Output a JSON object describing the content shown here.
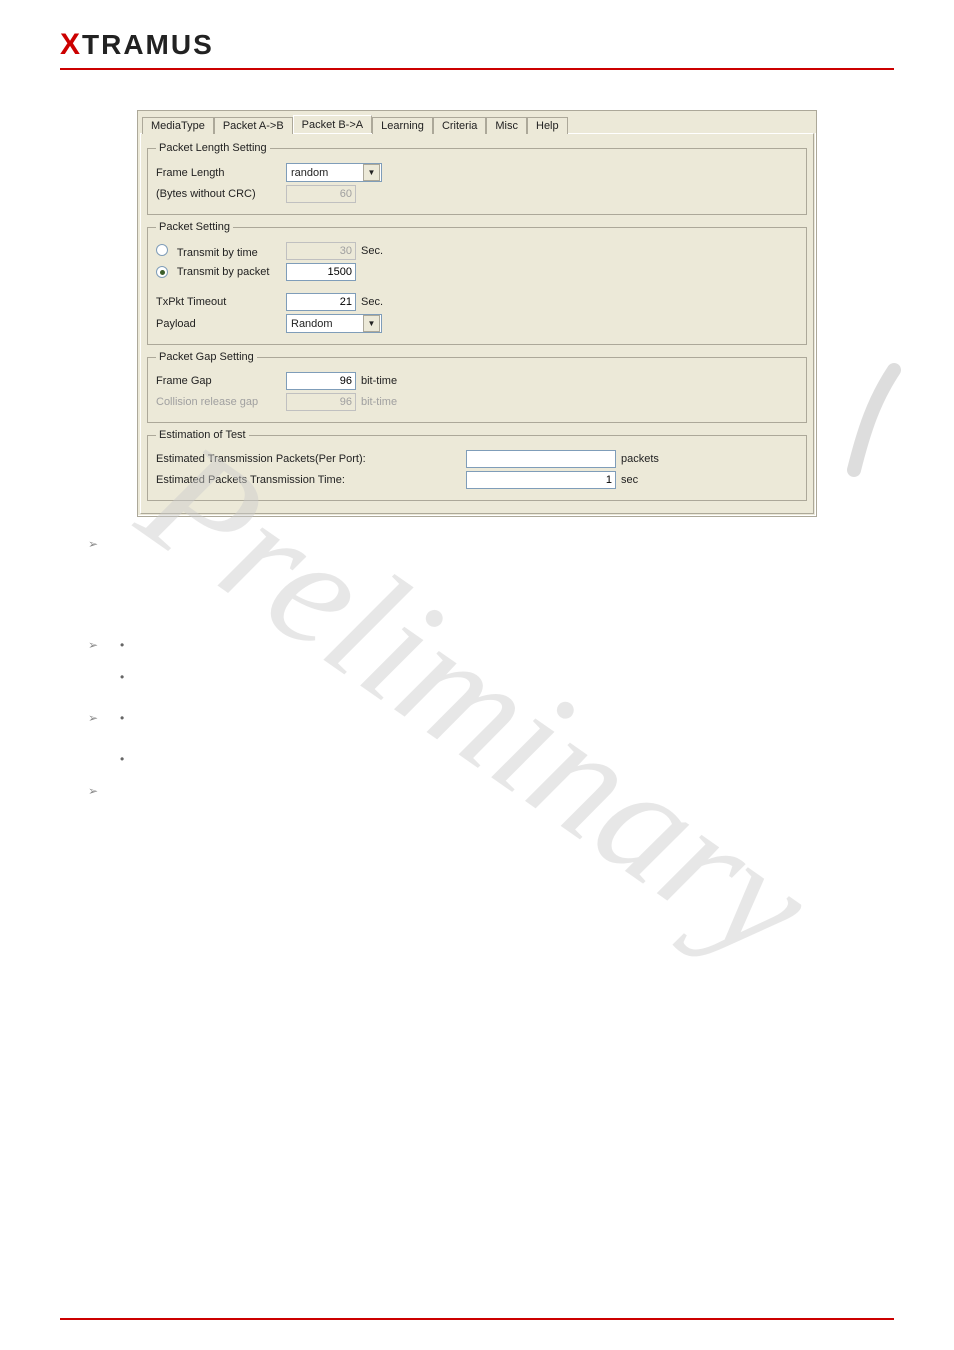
{
  "brand": "XTRAMUS",
  "tabs": [
    "MediaType",
    "Packet A->B",
    "Packet B->A",
    "Learning",
    "Criteria",
    "Misc",
    "Help"
  ],
  "activeTabIndex": 2,
  "groupLabels": {
    "lengthSetting": "Packet Length Setting",
    "packetSetting": "Packet Setting",
    "gapSetting": "Packet Gap Setting",
    "estimation": "Estimation of Test"
  },
  "length": {
    "frameLengthLabel": "Frame Length",
    "frameLengthValue": "random",
    "bytesLabel": "(Bytes without CRC)",
    "bytesValue": "60"
  },
  "packet": {
    "transmitByTimeLabel": "Transmit by time",
    "transmitByTimeValue": "30",
    "transmitByPacketLabel": "Transmit by packet",
    "transmitByPacketValue": "1500",
    "txPktTimeoutLabel": "TxPkt Timeout",
    "txPktTimeoutValue": "21",
    "payloadLabel": "Payload",
    "payloadValue": "Random",
    "secSuffix": "Sec."
  },
  "gap": {
    "frameGapLabel": "Frame Gap",
    "frameGapValue": "96",
    "collisionLabel": "Collision release gap",
    "collisionValue": "96",
    "bitTimeSuffix": "bit-time"
  },
  "estimation": {
    "packetsLabel": "Estimated Transmission Packets(Per Port):",
    "packetsValue": "",
    "packetsSuffix": "packets",
    "timeLabel": "Estimated Packets Transmission Time:",
    "timeValue": "1",
    "timeSuffix": "sec"
  },
  "watermark": "Preliminary"
}
